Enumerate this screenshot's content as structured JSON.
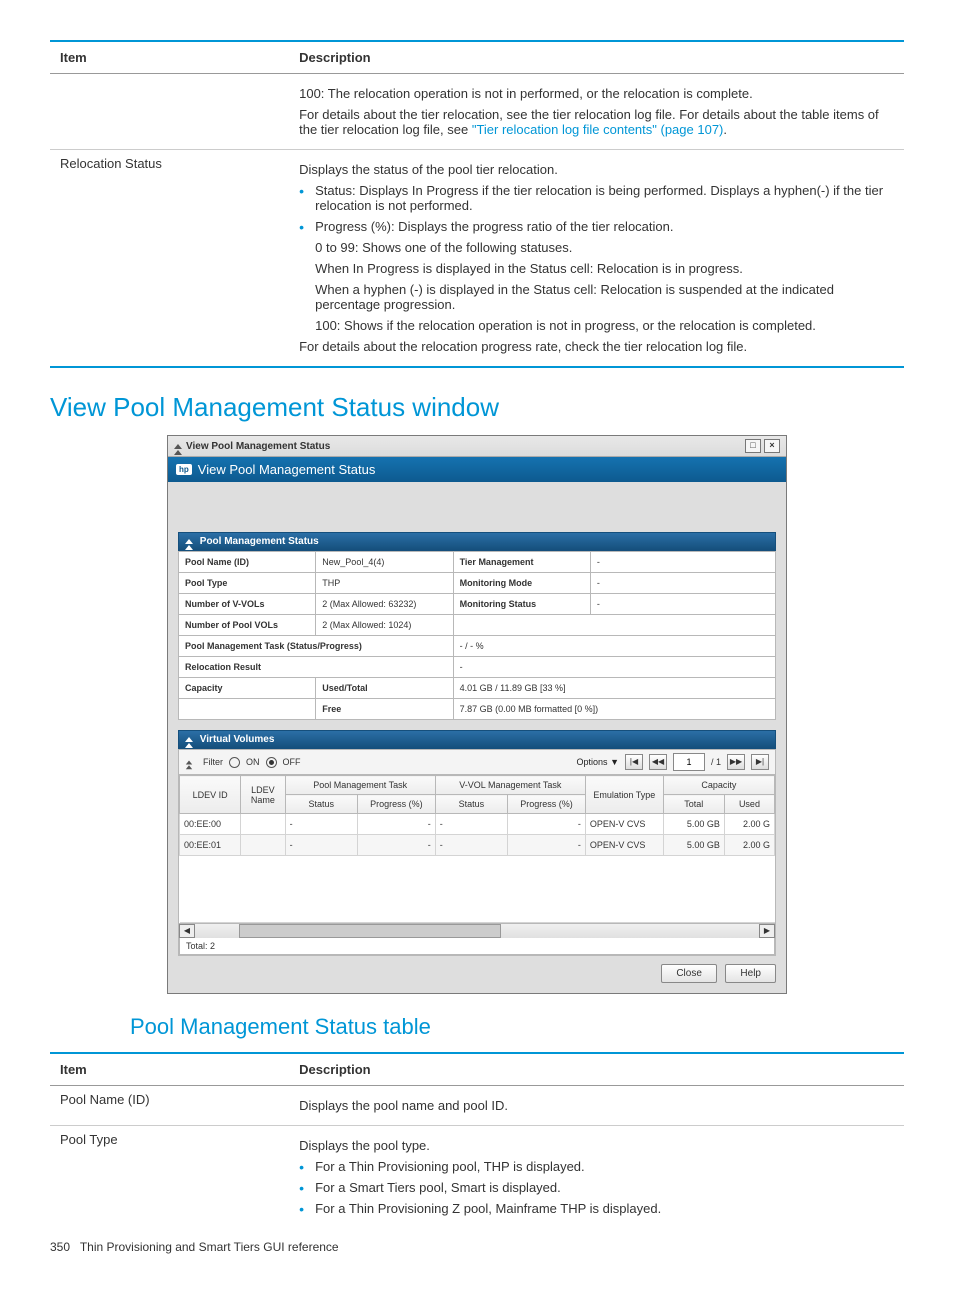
{
  "table1": {
    "headers": [
      "Item",
      "Description"
    ],
    "row1_desc": [
      "100: The relocation operation is not in performed, or the relocation is complete.",
      "For details about the tier relocation, see the tier relocation log file. For details about the table items of the tier relocation log file, see ",
      "\"Tier relocation log file contents\" (page 107)",
      "."
    ],
    "row2_item": "Relocation Status",
    "row2_desc": {
      "intro": "Displays the status of the pool tier relocation.",
      "bullets": [
        "Status: Displays In Progress if the tier relocation is being performed. Displays a hyphen(-) if the tier relocation is not performed.",
        "Progress (%): Displays the progress ratio of the tier relocation."
      ],
      "lines": [
        "0 to 99: Shows one of the following statuses.",
        "When In Progress is displayed in the Status cell: Relocation is in progress.",
        "When a hyphen (-) is displayed in the Status cell: Relocation is suspended at the indicated percentage progression.",
        "100: Shows if the relocation operation is not in progress, or the relocation is completed.",
        "For details about the relocation progress rate, check the tier relocation log file."
      ]
    }
  },
  "h1": "View Pool Management Status window",
  "screenshot": {
    "title": "View Pool Management Status",
    "bluebar": "View Pool Management Status",
    "status_hdr": "Pool Management Status",
    "kv": {
      "pool_name_lbl": "Pool Name (ID)",
      "pool_name": "New_Pool_4(4)",
      "tier_mgmt_lbl": "Tier Management",
      "tier_mgmt": "-",
      "pool_type_lbl": "Pool Type",
      "pool_type": "THP",
      "mon_mode_lbl": "Monitoring Mode",
      "mon_mode": "-",
      "num_vvols_lbl": "Number of V-VOLs",
      "num_vvols": "2 (Max Allowed: 63232)",
      "mon_status_lbl": "Monitoring Status",
      "mon_status": "-",
      "num_pvols_lbl": "Number of Pool VOLs",
      "num_pvols": "2 (Max Allowed: 1024)",
      "pm_task_lbl": "Pool Management Task (Status/Progress)",
      "pm_task": "- / - %",
      "reloc_lbl": "Relocation Result",
      "reloc": "-",
      "cap_lbl": "Capacity",
      "used_lbl": "Used/Total",
      "used": "4.01 GB / 11.89 GB [33 %]",
      "free_lbl": "Free",
      "free": "7.87 GB (0.00 MB formatted [0 %])"
    },
    "vv_hdr": "Virtual Volumes",
    "filter": {
      "label": "Filter",
      "on": "ON",
      "off": "OFF",
      "options": "Options",
      "page": "1",
      "pages": "/ 1"
    },
    "cols": {
      "ldevid": "LDEV ID",
      "ldevname": "LDEV Name",
      "pmt": "Pool Management Task",
      "status": "Status",
      "progress": "Progress (%)",
      "vvt": "V-VOL Management Task",
      "emul": "Emulation Type",
      "cap": "Capacity",
      "total": "Total",
      "used": "Used"
    },
    "rows": [
      {
        "id": "00:EE:00",
        "name": "",
        "pstat": "-",
        "pprog": "-",
        "vstat": "-",
        "vprog": "-",
        "emul": "OPEN-V CVS",
        "total": "5.00 GB",
        "used": "2.00 G"
      },
      {
        "id": "00:EE:01",
        "name": "",
        "pstat": "-",
        "pprog": "-",
        "vstat": "-",
        "vprog": "-",
        "emul": "OPEN-V CVS",
        "total": "5.00 GB",
        "used": "2.00 G"
      }
    ],
    "total_line": "Total: 2",
    "close": "Close",
    "help": "Help"
  },
  "h2": "Pool Management Status table",
  "table2": {
    "headers": [
      "Item",
      "Description"
    ],
    "rows": [
      {
        "item": "Pool Name (ID)",
        "desc": "Displays the pool name and pool ID."
      },
      {
        "item": "Pool Type",
        "desc": "Displays the pool type.",
        "bullets": [
          "For a Thin Provisioning pool, THP is displayed.",
          "For a Smart Tiers pool, Smart is displayed.",
          "For a Thin Provisioning Z pool, Mainframe THP is displayed."
        ]
      }
    ]
  },
  "footer": {
    "pnum": "350",
    "text": "Thin Provisioning and Smart Tiers GUI reference"
  }
}
